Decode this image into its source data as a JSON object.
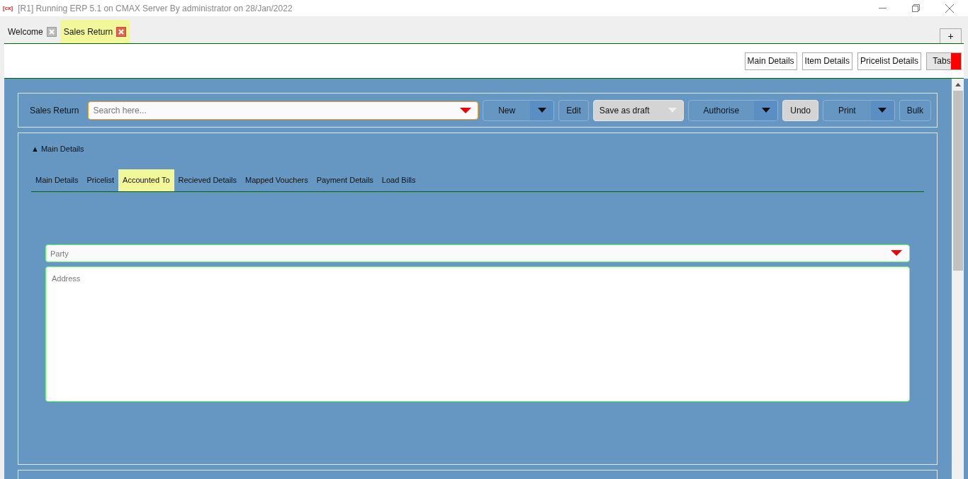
{
  "window": {
    "logo": "[cx]",
    "title": "[R1] Running ERP 5.1 on CMAX Server By administrator on 28/Jan/2022"
  },
  "doc_tabs": [
    {
      "label": "Welcome",
      "selected": false
    },
    {
      "label": "Sales Return",
      "selected": true
    }
  ],
  "new_tab": "+",
  "section_buttons": [
    {
      "label": "Main Details",
      "kind": "plain"
    },
    {
      "label": "Item Details",
      "kind": "plain"
    },
    {
      "label": "Pricelist Details",
      "kind": "plain"
    },
    {
      "label": "Tabs",
      "kind": "flagged"
    }
  ],
  "voucher_bar": {
    "label": "Sales Return",
    "search": {
      "placeholder": "Search here..."
    },
    "buttons": [
      {
        "label": "New",
        "kind": "split",
        "disabled": false
      },
      {
        "label": "Edit",
        "kind": "plain",
        "disabled": false
      },
      {
        "label": "Save as draft",
        "kind": "dropdown",
        "disabled": true
      },
      {
        "label": "Authorise",
        "kind": "split",
        "disabled": false
      },
      {
        "label": "Undo",
        "kind": "plain",
        "disabled": true
      },
      {
        "label": "Print",
        "kind": "split",
        "disabled": false
      },
      {
        "label": "Bulk",
        "kind": "plain",
        "disabled": false
      }
    ]
  },
  "details": {
    "title": "▲ Main Details",
    "tabs": [
      {
        "label": "Main Details",
        "selected": false
      },
      {
        "label": "Pricelist",
        "selected": false
      },
      {
        "label": "Accounted To",
        "selected": true
      },
      {
        "label": "Recieved Details",
        "selected": false
      },
      {
        "label": "Mapped Vouchers",
        "selected": false
      },
      {
        "label": "Payment Details",
        "selected": false
      },
      {
        "label": "Load Bills",
        "selected": false
      }
    ],
    "party": {
      "placeholder": "Party"
    },
    "address": {
      "placeholder": "Address"
    }
  }
}
